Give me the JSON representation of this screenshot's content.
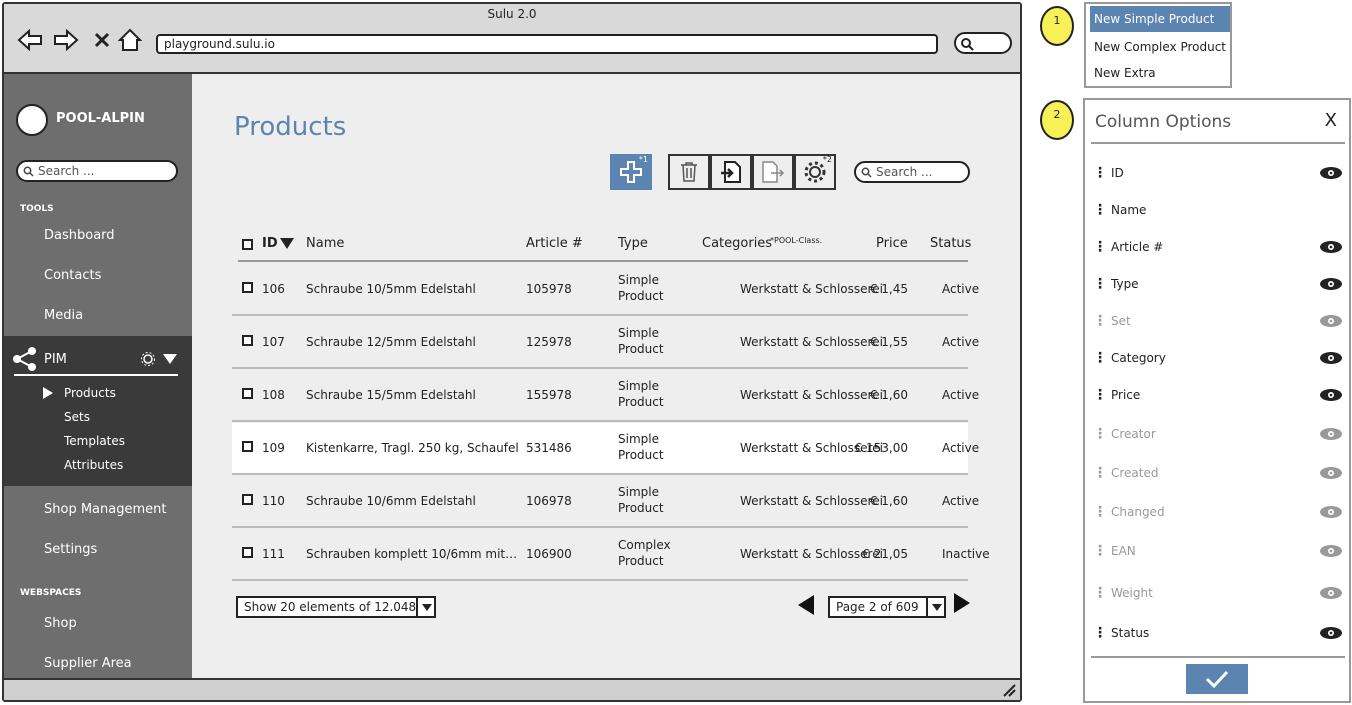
{
  "window": {
    "title": "Sulu 2.0",
    "url": "playground.sulu.io"
  },
  "sidebar": {
    "brand": "POOL-ALPIN",
    "search_placeholder": "Search ...",
    "tools_label": "TOOLS",
    "tools": [
      "Dashboard",
      "Contacts",
      "Media"
    ],
    "pim": {
      "label": "PIM",
      "items": [
        "Products",
        "Sets",
        "Templates",
        "Attributes"
      ]
    },
    "more": [
      "Shop Management",
      "Settings"
    ],
    "webspaces_label": "WEBSPACES",
    "webspaces": [
      "Shop",
      "Supplier Area"
    ]
  },
  "main": {
    "title": "Products",
    "search_placeholder": "Search ...",
    "add_sup": "*1",
    "settings_sup": "*2",
    "columns": [
      "ID",
      "Name",
      "Article #",
      "Type",
      "Categories",
      "Price",
      "Status"
    ],
    "categories_note": "*POOL-Class.",
    "rows": [
      {
        "id": "106",
        "name": "Schraube 10/5mm Edelstahl",
        "article": "105978",
        "type1": "Simple",
        "type2": "Product",
        "category": "Werkstatt & Schlosserei",
        "price": "€ 1,45",
        "status": "Active"
      },
      {
        "id": "107",
        "name": "Schraube 12/5mm Edelstahl",
        "article": "125978",
        "type1": "Simple",
        "type2": "Product",
        "category": "Werkstatt & Schlosserei",
        "price": "€ 1,55",
        "status": "Active"
      },
      {
        "id": "108",
        "name": "Schraube 15/5mm Edelstahl",
        "article": "155978",
        "type1": "Simple",
        "type2": "Product",
        "category": "Werkstatt & Schlosserei",
        "price": "€ 1,60",
        "status": "Active"
      },
      {
        "id": "109",
        "name": "Kistenkarre, Tragl. 250 kg, Schaufel",
        "article": "531486",
        "type1": "Simple",
        "type2": "Product",
        "category": "Werkstatt & Schlosserei",
        "price": "€ 153,00",
        "status": "Active"
      },
      {
        "id": "110",
        "name": "Schraube 10/6mm Edelstahl",
        "article": "106978",
        "type1": "Simple",
        "type2": "Product",
        "category": "Werkstatt & Schlosserei",
        "price": "€ 1,60",
        "status": "Active"
      },
      {
        "id": "111",
        "name": "Schrauben komplett 10/6mm mit…",
        "article": "106900",
        "type1": "Complex",
        "type2": "Product",
        "category": "Werkstatt & Schlosserei",
        "price": "€ 21,05",
        "status": "Inactive"
      }
    ],
    "page_size": "Show 20 elements of 12.048",
    "pagination": "Page 2 of 609"
  },
  "annotations": {
    "badge1": "1",
    "badge2": "2",
    "new_menu": [
      "New Simple Product",
      "New Complex Product",
      "New Extra"
    ],
    "column_options": {
      "title": "Column Options",
      "close": "X",
      "items": [
        {
          "label": "ID",
          "visible": true
        },
        {
          "label": "Name",
          "visible": true
        },
        {
          "label": "Article #",
          "visible": true
        },
        {
          "label": "Type",
          "visible": true
        },
        {
          "label": "Set",
          "visible": false
        },
        {
          "label": "Category",
          "visible": true
        },
        {
          "label": "Price",
          "visible": true
        },
        {
          "label": "Creator",
          "visible": false
        },
        {
          "label": "Created",
          "visible": false
        },
        {
          "label": "Changed",
          "visible": false
        },
        {
          "label": "EAN",
          "visible": false
        },
        {
          "label": "Weight",
          "visible": false
        },
        {
          "label": "Status",
          "visible": true
        }
      ]
    }
  },
  "colors": {
    "accent": "#5b84b1",
    "sidebar": "#6e6e6e",
    "sidebar_active": "#3a3a3a",
    "badge": "#f7f056"
  }
}
